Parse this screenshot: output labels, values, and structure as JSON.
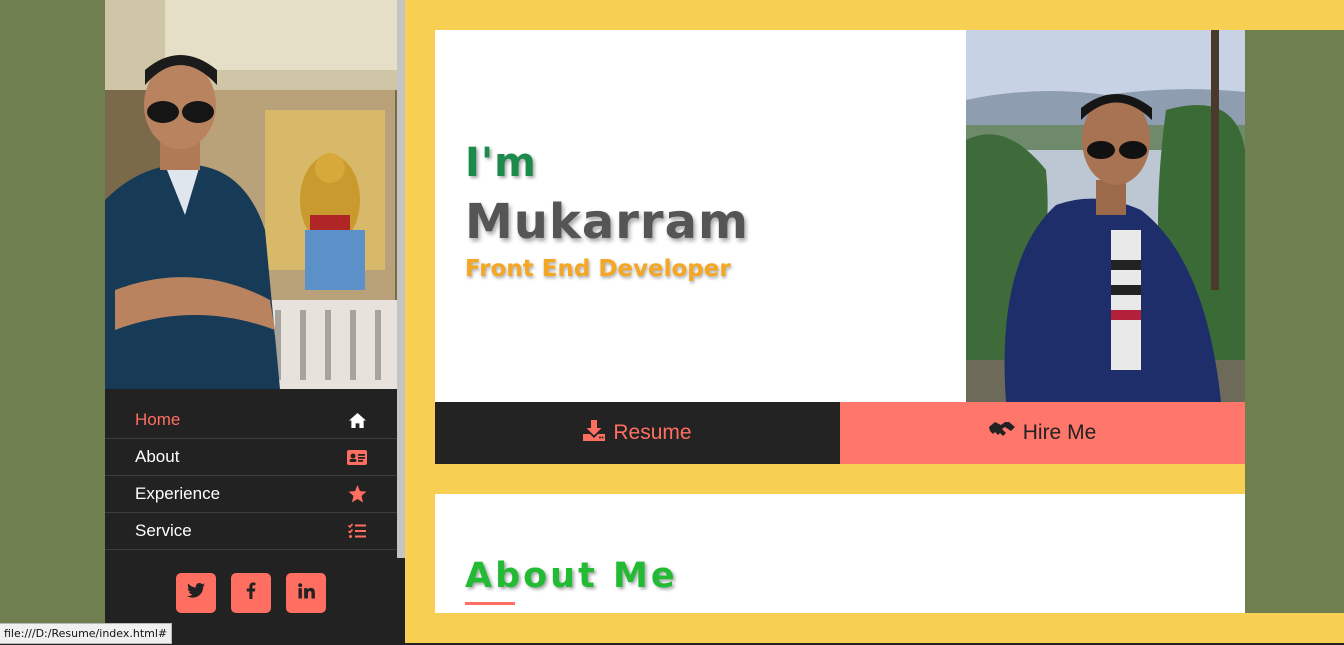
{
  "sidebar": {
    "nav": [
      {
        "label": "Home",
        "icon": "home-icon",
        "active": true
      },
      {
        "label": "About",
        "icon": "id-card-icon",
        "active": false
      },
      {
        "label": "Experience",
        "icon": "star-icon",
        "active": false
      },
      {
        "label": "Service",
        "icon": "list-check-icon",
        "active": false
      }
    ],
    "social": [
      {
        "icon": "twitter-icon",
        "glyph": "🐦"
      },
      {
        "icon": "facebook-icon",
        "glyph": "f"
      },
      {
        "icon": "linkedin-icon",
        "glyph": "in"
      }
    ]
  },
  "hero": {
    "greeting": "I'm",
    "name": "Mukarram",
    "role": "Front End Developer"
  },
  "actions": {
    "resume_label": "Resume",
    "hire_label": "Hire Me"
  },
  "about": {
    "title": "About Me"
  },
  "status_bar": {
    "url": "file:///D:/Resume/index.html#"
  },
  "colors": {
    "accent": "#ff6f61",
    "yellow": "#f7cf52",
    "olive": "#6f7f4f",
    "dark": "#222222",
    "greeting_green": "#1c8a4a",
    "about_green": "#22bb33",
    "role_orange": "#f5a623"
  }
}
